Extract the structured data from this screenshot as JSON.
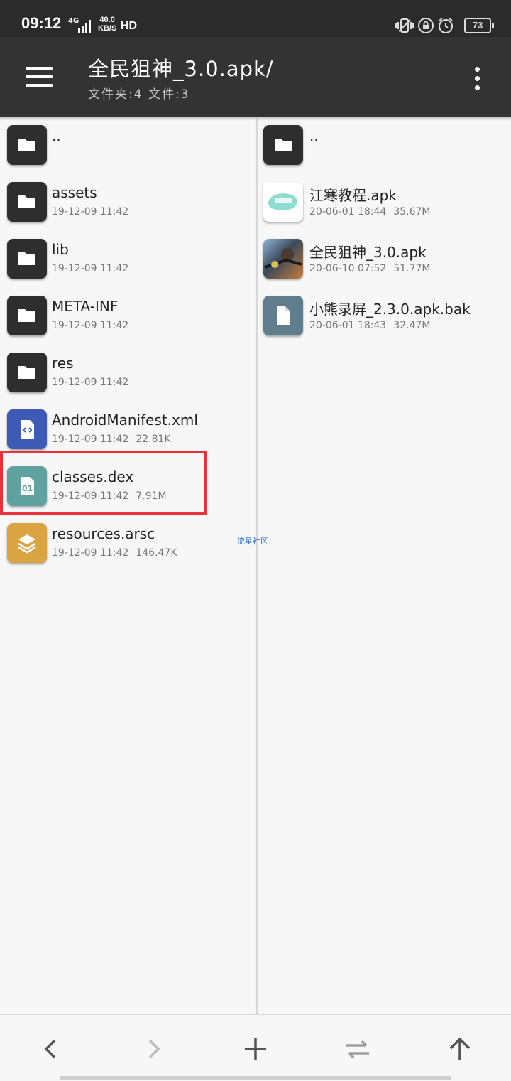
{
  "status": {
    "time": "09:12",
    "network": "4G",
    "speed_value": "40.0",
    "speed_unit": "KB/S",
    "hd": "HD",
    "battery": "73",
    "icons": [
      "signal-icon",
      "vibrate-icon",
      "lock-rotation-icon",
      "alarm-icon",
      "battery-icon"
    ]
  },
  "appbar": {
    "title": "全民狙神_3.0.apk/",
    "subtitle": "文件夹:4 文件:3",
    "menu_icon": "hamburger-menu-icon",
    "more_icon": "more-vertical-icon"
  },
  "left_pane": {
    "items": [
      {
        "name": "..",
        "date": "",
        "size": "",
        "icon": "folder-icon"
      },
      {
        "name": "assets",
        "date": "19-12-09 11:42",
        "size": "",
        "icon": "folder-icon"
      },
      {
        "name": "lib",
        "date": "19-12-09 11:42",
        "size": "",
        "icon": "folder-icon"
      },
      {
        "name": "META-INF",
        "date": "19-12-09 11:42",
        "size": "",
        "icon": "folder-icon"
      },
      {
        "name": "res",
        "date": "19-12-09 11:42",
        "size": "",
        "icon": "folder-icon"
      },
      {
        "name": "AndroidManifest.xml",
        "date": "19-12-09 11:42",
        "size": "22.81K",
        "icon": "xml-file-icon"
      },
      {
        "name": "classes.dex",
        "date": "19-12-09 11:42",
        "size": "7.91M",
        "icon": "dex-file-icon",
        "icon_text": "01"
      },
      {
        "name": "resources.arsc",
        "date": "19-12-09 11:42",
        "size": "146.47K",
        "icon": "layers-file-icon"
      }
    ]
  },
  "right_pane": {
    "items": [
      {
        "name": "..",
        "date": "",
        "size": "",
        "icon": "folder-icon"
      },
      {
        "name": "江寒教程.apk",
        "date": "20-06-01 18:44",
        "size": "35.67M",
        "icon": "apk-app-icon"
      },
      {
        "name": "全民狙神_3.0.apk",
        "date": "20-06-10 07:52",
        "size": "51.77M",
        "icon": "game-app-icon"
      },
      {
        "name": "小熊录屏_2.3.0.apk.bak",
        "date": "20-06-01 18:43",
        "size": "32.47M",
        "icon": "generic-file-icon"
      }
    ]
  },
  "watermark": "流星社区",
  "highlight_color": "#e8313b",
  "bottom_bar": {
    "buttons": [
      "back-icon",
      "forward-icon",
      "add-icon",
      "swap-icon",
      "up-icon"
    ]
  }
}
